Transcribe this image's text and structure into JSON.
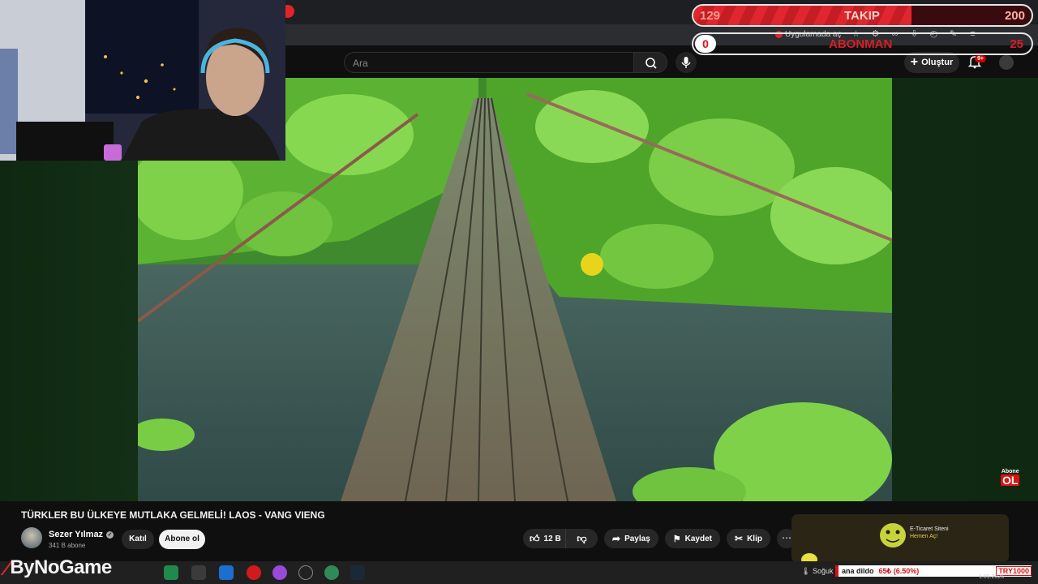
{
  "header": {
    "search_placeholder": "Ara",
    "create_label": "Oluştur",
    "notification_badge": "9+",
    "open_in_app": "Uygulamada aç"
  },
  "stream_widget": {
    "follow": {
      "current": "129",
      "label": "TAKIP",
      "target": "200",
      "progress": 0.645
    },
    "subscribe": {
      "current": "0",
      "label": "ABONMAN",
      "target": "25",
      "progress": 0
    }
  },
  "overlay": {
    "abone_small": "Abone",
    "abone_big": "OL"
  },
  "video": {
    "title": "TÜRKLER BU ÜLKEYE MUTLAKA GELMELİ! LAOS - VANG VIENG",
    "channel_name": "Sezer Yılmaz",
    "channel_subs": "341 B abone",
    "join_label": "Katıl",
    "subscribe_label": "Abone ol",
    "likes": "12 B",
    "share_label": "Paylaş",
    "save_label": "Kaydet",
    "clip_label": "Klip",
    "more_label": "⋯"
  },
  "ad": {
    "line1": "E-Ticaret Siteni",
    "line2": "Hemen Aç!"
  },
  "branding": {
    "logo_text": "ByNoGame"
  },
  "taskbar": {
    "weather": "Soğuk",
    "ticker_text": "ana dildo",
    "ticker_change": "65₺ (6.50%)",
    "ticker_currency": "TRY1000",
    "date": "1.01.2025"
  },
  "colors": {
    "accent_red": "#e0262e",
    "stage_green": "#133016",
    "yt_bg": "#0f0f0f"
  }
}
